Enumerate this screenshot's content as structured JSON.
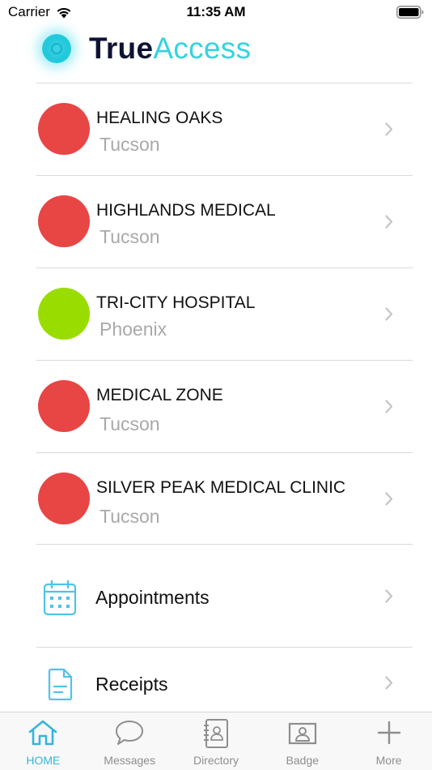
{
  "status_bar": {
    "carrier": "Carrier",
    "time": "11:35 AM"
  },
  "header": {
    "logo_true": "True",
    "logo_access": "Access"
  },
  "colors": {
    "status_red": "#e84545",
    "status_green": "#99dd00",
    "accent": "#35b5da",
    "icon_blue": "#4fc3e8"
  },
  "facilities": [
    {
      "name": "HEALING OAKS",
      "city": "Tucson",
      "status": "red"
    },
    {
      "name": "HIGHLANDS MEDICAL",
      "city": "Tucson",
      "status": "red"
    },
    {
      "name": "TRI-CITY HOSPITAL",
      "city": "Phoenix",
      "status": "green"
    },
    {
      "name": "MEDICAL ZONE",
      "city": "Tucson",
      "status": "red"
    },
    {
      "name": "SILVER PEAK MEDICAL CLINIC",
      "city": "Tucson",
      "status": "red"
    }
  ],
  "menu": {
    "appointments": {
      "label": "Appointments",
      "icon": "calendar-icon"
    },
    "receipts": {
      "label": "Receipts",
      "icon": "receipt-icon"
    }
  },
  "tabs": [
    {
      "label": "HOME",
      "icon": "home-icon",
      "active": true
    },
    {
      "label": "Messages",
      "icon": "chat-bubble-icon",
      "active": false
    },
    {
      "label": "Directory",
      "icon": "address-book-icon",
      "active": false
    },
    {
      "label": "Badge",
      "icon": "badge-icon",
      "active": false
    },
    {
      "label": "More",
      "icon": "plus-icon",
      "active": false
    }
  ]
}
